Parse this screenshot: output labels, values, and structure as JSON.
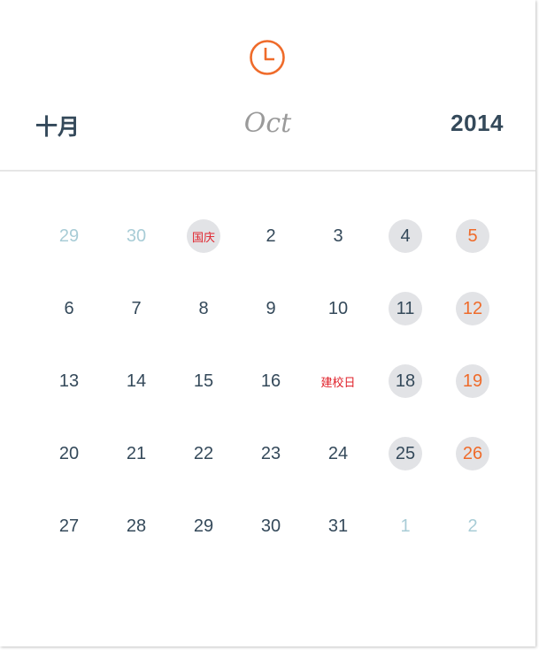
{
  "header": {
    "month_cn": "十月",
    "month_en": "Oct",
    "year": "2014",
    "clock_icon_color": "#ef6b2a"
  },
  "weeks": [
    [
      {
        "label": "29",
        "type": "other"
      },
      {
        "label": "30",
        "type": "other"
      },
      {
        "label": "国庆",
        "type": "holiday-hl"
      },
      {
        "label": "2",
        "type": "normal"
      },
      {
        "label": "3",
        "type": "normal"
      },
      {
        "label": "4",
        "type": "sat"
      },
      {
        "label": "5",
        "type": "sun"
      }
    ],
    [
      {
        "label": "6",
        "type": "normal"
      },
      {
        "label": "7",
        "type": "normal"
      },
      {
        "label": "8",
        "type": "normal"
      },
      {
        "label": "9",
        "type": "normal"
      },
      {
        "label": "10",
        "type": "normal"
      },
      {
        "label": "11",
        "type": "sat"
      },
      {
        "label": "12",
        "type": "sun"
      }
    ],
    [
      {
        "label": "13",
        "type": "normal"
      },
      {
        "label": "14",
        "type": "normal"
      },
      {
        "label": "15",
        "type": "normal"
      },
      {
        "label": "16",
        "type": "normal"
      },
      {
        "label": "建校日",
        "type": "holiday"
      },
      {
        "label": "18",
        "type": "sat"
      },
      {
        "label": "19",
        "type": "sun"
      }
    ],
    [
      {
        "label": "20",
        "type": "normal"
      },
      {
        "label": "21",
        "type": "normal"
      },
      {
        "label": "22",
        "type": "normal"
      },
      {
        "label": "23",
        "type": "normal"
      },
      {
        "label": "24",
        "type": "normal"
      },
      {
        "label": "25",
        "type": "sat"
      },
      {
        "label": "26",
        "type": "sun"
      }
    ],
    [
      {
        "label": "27",
        "type": "normal"
      },
      {
        "label": "28",
        "type": "normal"
      },
      {
        "label": "29",
        "type": "normal"
      },
      {
        "label": "30",
        "type": "normal"
      },
      {
        "label": "31",
        "type": "normal"
      },
      {
        "label": "1",
        "type": "other"
      },
      {
        "label": "2",
        "type": "other"
      }
    ]
  ],
  "colors": {
    "text": "#34495a",
    "other_month": "#a8ccd6",
    "weekend_bg": "#e2e3e6",
    "sunday": "#ef6b2a",
    "holiday": "#e0212a"
  }
}
